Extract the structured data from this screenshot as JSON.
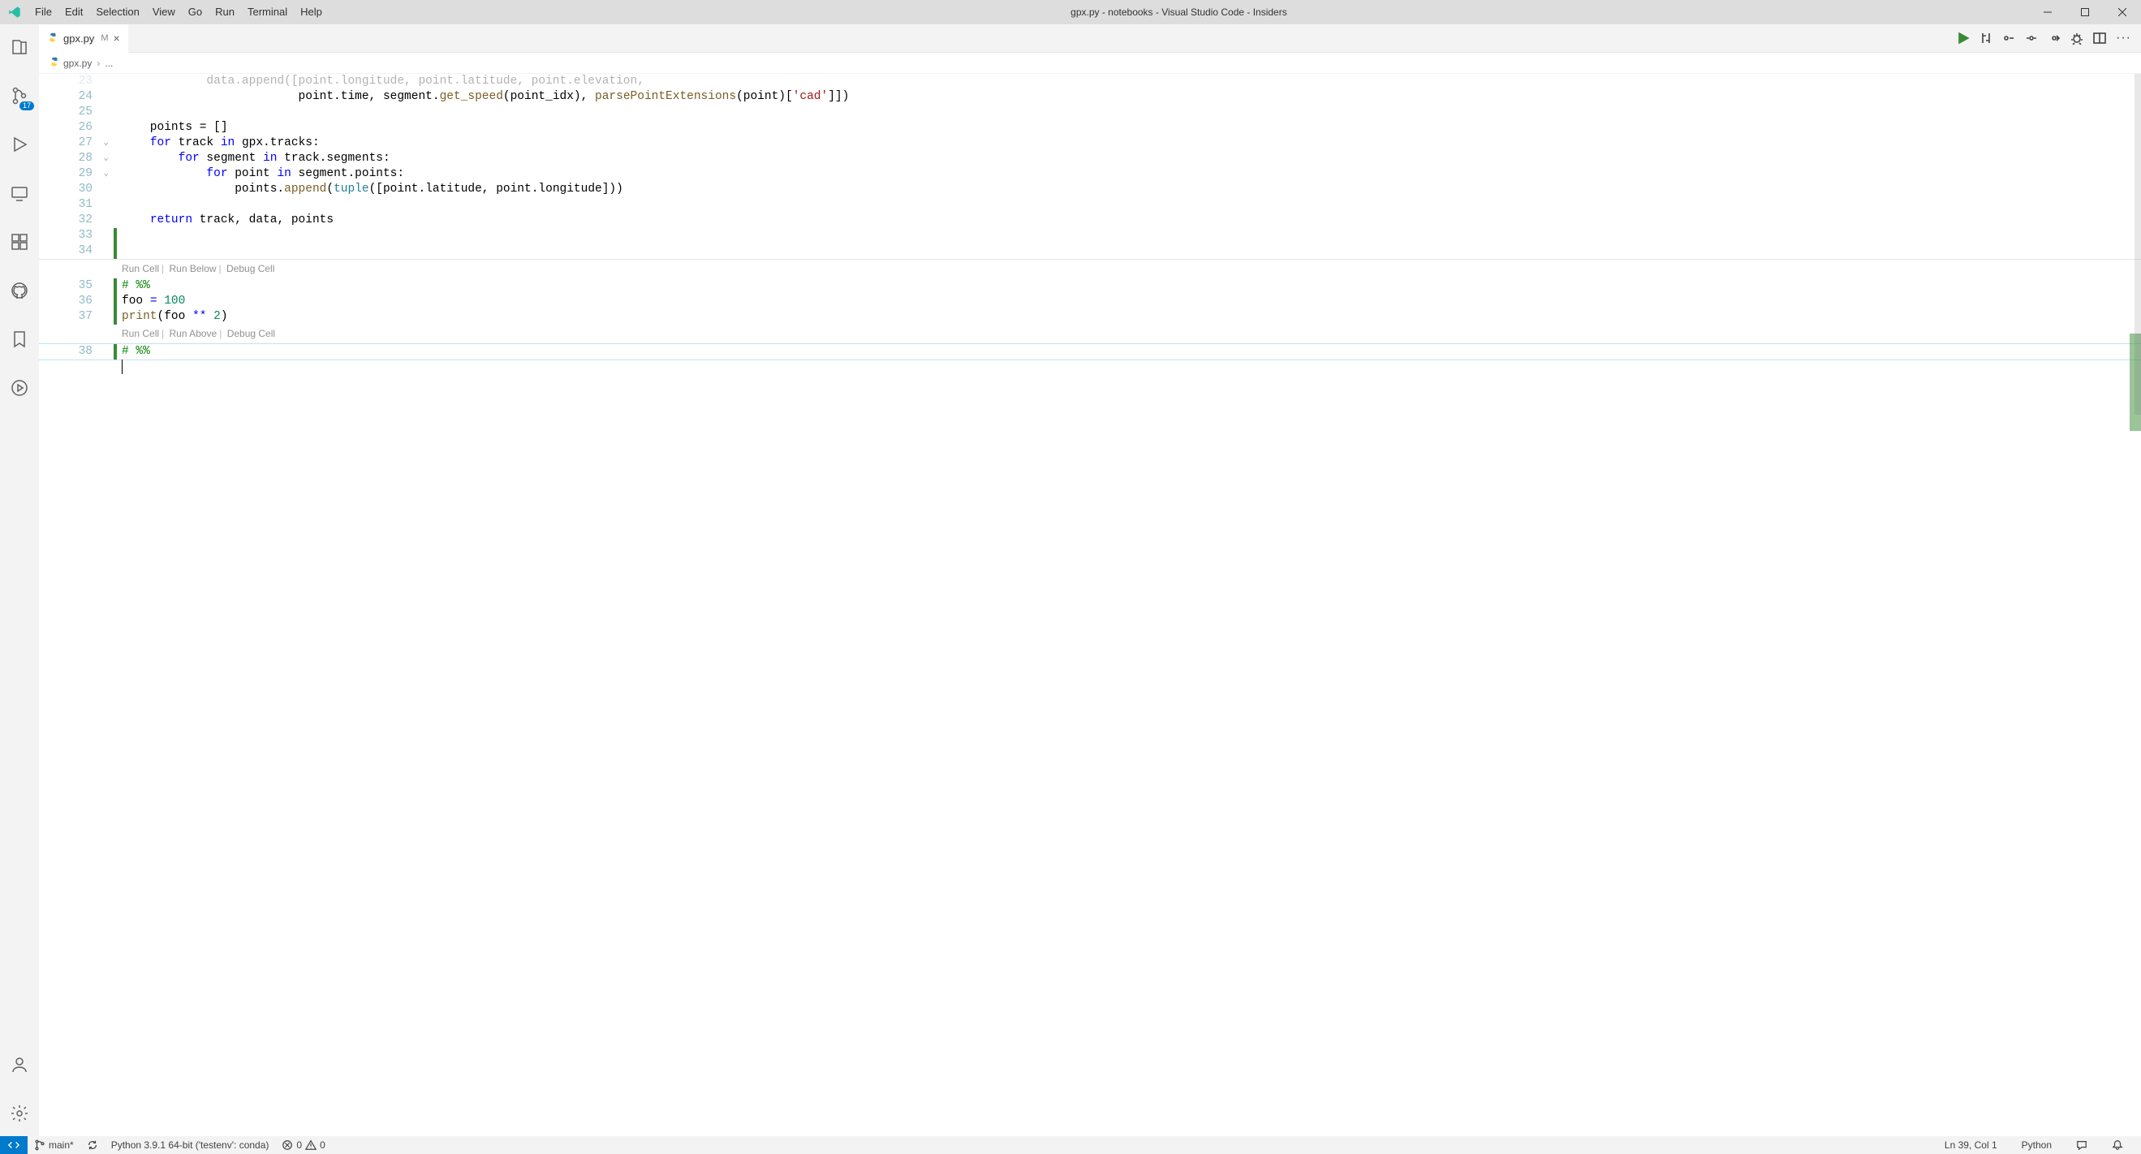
{
  "window": {
    "title": "gpx.py - notebooks - Visual Studio Code - Insiders"
  },
  "menu": {
    "items": [
      "File",
      "Edit",
      "Selection",
      "View",
      "Go",
      "Run",
      "Terminal",
      "Help"
    ]
  },
  "activity": {
    "scm_badge": "17"
  },
  "tabs": {
    "open": [
      {
        "file": "gpx.py",
        "status": "M"
      }
    ]
  },
  "breadcrumb": {
    "items": [
      "gpx.py",
      "..."
    ]
  },
  "editor_actions": {
    "more": "···"
  },
  "codelens": {
    "cell1": {
      "run_cell": "Run Cell",
      "run_below": "Run Below",
      "debug_cell": "Debug Cell"
    },
    "cell2": {
      "run_cell": "Run Cell",
      "run_above": "Run Above",
      "debug_cell": "Debug Cell"
    }
  },
  "code": {
    "l23": "            data.append([point.longitude, point.latitude, point.elevation,",
    "l24a": "                         point.time, segment.",
    "l24b": "get_speed",
    "l24c": "(point_idx), ",
    "l24d": "parsePointExtensions",
    "l24e": "(point)[",
    "l24f": "'cad'",
    "l24g": "]])",
    "l26a": "    points = []",
    "l27a": "for",
    "l27b": " track ",
    "l27c": "in",
    "l27d": " gpx.tracks:",
    "l28a": "for",
    "l28b": " segment ",
    "l28c": "in",
    "l28d": " track.segments:",
    "l29a": "for",
    "l29b": " point ",
    "l29c": "in",
    "l29d": " segment.points:",
    "l30a": "                points.",
    "l30b": "append",
    "l30c": "(",
    "l30d": "tuple",
    "l30e": "([point.latitude, point.longitude]))",
    "l32a": "return",
    "l32b": " track, data, points",
    "l35": "# %%",
    "l36a": "foo ",
    "l36b": "=",
    "l36c": " ",
    "l36d": "100",
    "l37a": "print",
    "l37b": "(foo ",
    "l37c": "**",
    "l37d": " ",
    "l37e": "2",
    "l37f": ")",
    "l38": "# %%"
  },
  "line_numbers": {
    "n23": "23",
    "n24": "24",
    "n25": "25",
    "n26": "26",
    "n27": "27",
    "n28": "28",
    "n29": "29",
    "n30": "30",
    "n31": "31",
    "n32": "32",
    "n33": "33",
    "n34": "34",
    "n35": "35",
    "n36": "36",
    "n37": "37",
    "n38": "38"
  },
  "status": {
    "branch": "main*",
    "python": "Python 3.9.1 64-bit ('testenv': conda)",
    "errors": "0",
    "warnings": "0",
    "cursor": "Ln 39, Col 1",
    "language": "Python"
  }
}
